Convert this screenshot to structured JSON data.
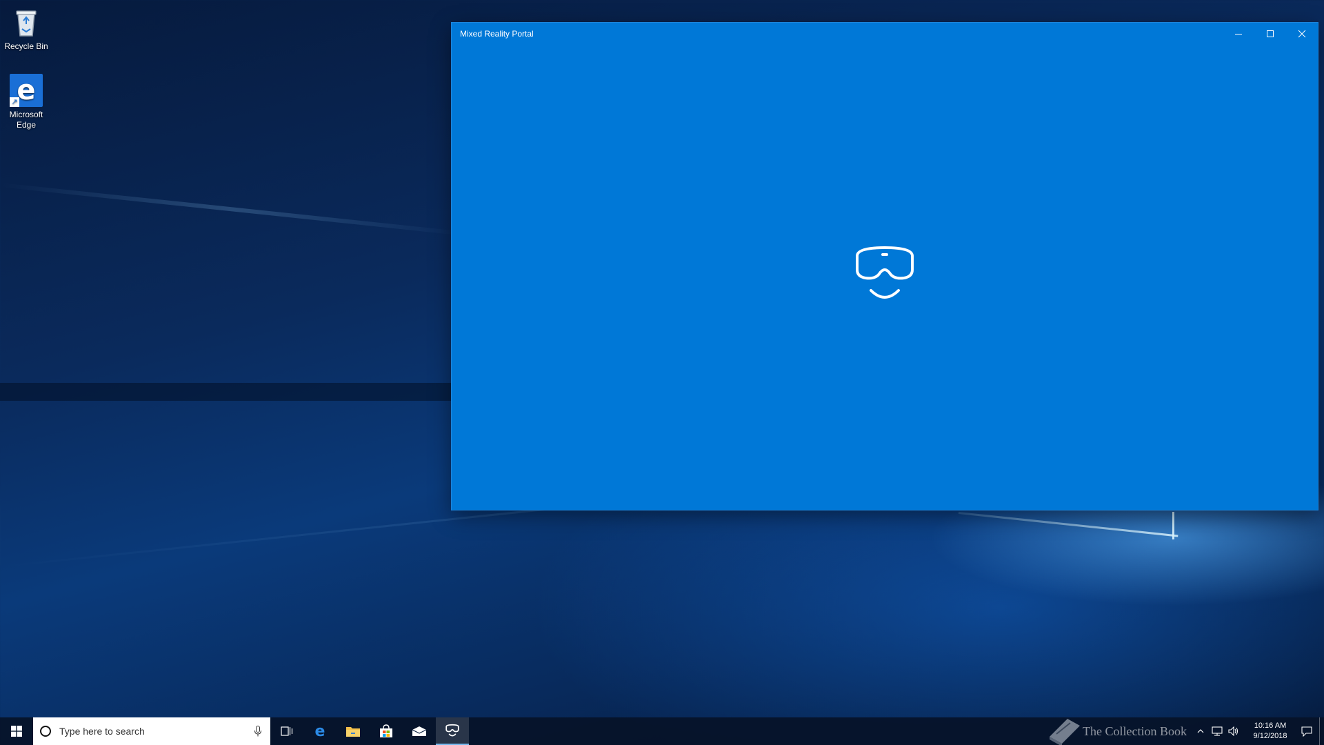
{
  "desktop": {
    "icons": [
      {
        "label": "Recycle Bin",
        "icon": "recycle-bin-icon"
      },
      {
        "label": "Microsoft Edge",
        "icon": "edge-icon"
      }
    ]
  },
  "window": {
    "title": "Mixed Reality Portal",
    "background_color": "#0078d7",
    "controls": {
      "minimize": "minimize-icon",
      "maximize": "maximize-icon",
      "close": "close-icon"
    },
    "splash_icon": "mixed-reality-headset-icon"
  },
  "taskbar": {
    "search": {
      "placeholder": "Type here to search"
    },
    "pinned": [
      {
        "name": "task-view",
        "icon": "task-view-icon"
      },
      {
        "name": "edge",
        "icon": "edge-icon"
      },
      {
        "name": "file-explorer",
        "icon": "folder-icon"
      },
      {
        "name": "store",
        "icon": "store-bag-icon"
      },
      {
        "name": "mail",
        "icon": "mail-icon"
      },
      {
        "name": "mixed-reality-portal",
        "icon": "mixed-reality-headset-icon",
        "active": true
      }
    ],
    "watermark": "The Collection Book",
    "clock": {
      "time": "10:16 AM",
      "date": "9/12/2018"
    }
  }
}
